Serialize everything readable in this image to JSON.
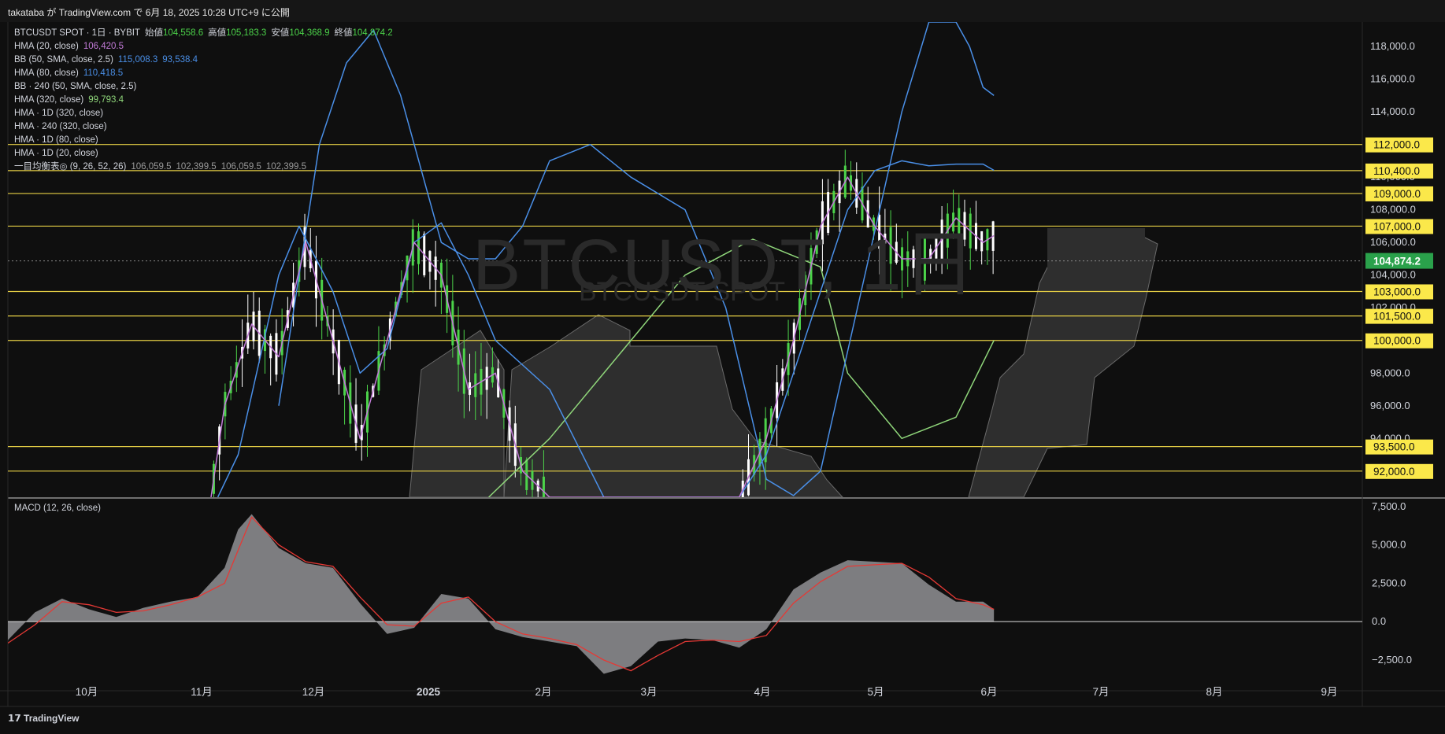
{
  "header": {
    "text": "takataba が TradingView.com で 6月 18, 2025 10:28 UTC+9 に公開"
  },
  "footer": {
    "brand": "TradingView"
  },
  "watermark": {
    "main": "BTCUSDT, 1日",
    "sub": "BTCUSDT SPOT"
  },
  "colors": {
    "bg": "#0f0f0f",
    "up": "#4cd34a",
    "down": "#ffffff",
    "bb": "#4a8fe7",
    "hma20": "#c27bd8",
    "hma320": "#8fd67a",
    "level": "#e6cf45",
    "level_label_bg": "#fbe84a",
    "price_label_bg": "#2aa14b",
    "macd_hist": "#7d7d80",
    "macd_signal": "#e53935"
  },
  "legend": [
    {
      "label": "BTCUSDT SPOT · 1日 · BYBIT",
      "parts": [
        [
          "始値",
          "104,558.6"
        ],
        [
          "高値",
          "105,183.3"
        ],
        [
          "安値",
          "104,368.9"
        ],
        [
          "終値",
          "104,874.2"
        ]
      ]
    },
    {
      "label": "HMA (20, close)",
      "values": [
        "106,420.5"
      ],
      "color": "#c27bd8"
    },
    {
      "label": "BB (50, SMA, close, 2.5)",
      "values": [
        "115,008.3",
        "93,538.4"
      ],
      "color": "#4a8fe7"
    },
    {
      "label": "HMA (80, close)",
      "values": [
        "110,418.5"
      ],
      "color": "#4a8fe7"
    },
    {
      "label": "BB · 240 (50, SMA, close, 2.5)",
      "values": []
    },
    {
      "label": "HMA (320, close)",
      "values": [
        "99,793.4"
      ],
      "color": "#8fd67a"
    },
    {
      "label": "HMA · 1D (320, close)",
      "values": []
    },
    {
      "label": "HMA · 240 (320, close)",
      "values": []
    },
    {
      "label": "HMA · 1D (80, close)",
      "values": []
    },
    {
      "label": "HMA · 1D (20, close)",
      "values": []
    },
    {
      "label": "一目均衡表◎ (9, 26, 52, 26)",
      "values": [
        "106,059.5",
        "102,399.5",
        "106,059.5",
        "102,399.5"
      ],
      "color": "#9a9a9a"
    }
  ],
  "macd_label": "MACD (12, 26, close)",
  "chart_data": [
    {
      "type": "line",
      "title": "BTCUSDT SPOT · 1日 · BYBIT",
      "ylim": [
        90400,
        119500
      ],
      "y_ticks": [
        "94,000.0",
        "96,000.0",
        "98,000.0",
        "100,000.0",
        "102,000.0",
        "104,000.0",
        "106,000.0",
        "108,000.0",
        "110,000.0",
        "112,000.0",
        "114,000.0",
        "116,000.0",
        "118,000.0"
      ],
      "y_tick_values": [
        94000,
        96000,
        98000,
        100000,
        102000,
        104000,
        106000,
        108000,
        110000,
        112000,
        114000,
        116000,
        118000
      ],
      "x_ticks": [
        "10月",
        "11月",
        "12月",
        "2025",
        "2月",
        "3月",
        "4月",
        "5月",
        "6月",
        "7月",
        "8月",
        "9月"
      ],
      "current_price": {
        "value": 104874.2,
        "label": "104,874.2"
      },
      "levels": [
        {
          "value": 112000,
          "label": "112,000.0"
        },
        {
          "value": 110400,
          "label": "110,400.0"
        },
        {
          "value": 109000,
          "label": "109,000.0"
        },
        {
          "value": 107000,
          "label": "107,000.0"
        },
        {
          "value": 103000,
          "label": "103,000.0"
        },
        {
          "value": 101500,
          "label": "101,500.0"
        },
        {
          "value": 100000,
          "label": "100,000.0"
        },
        {
          "value": 93500,
          "label": "93,500.0"
        },
        {
          "value": 92000,
          "label": "92,000.0"
        }
      ],
      "series": [
        {
          "name": "HMA (320, close)",
          "x": [
            0.355,
            0.4,
            0.45,
            0.5,
            0.55,
            0.6,
            0.62,
            0.66,
            0.7,
            0.728
          ],
          "values": [
            90400,
            94000,
            99000,
            104000,
            106200,
            104500,
            98000,
            94000,
            95300,
            100000
          ]
        },
        {
          "name": "BB (50, SMA, close, 2.5)",
          "x": [
            0.2,
            0.23,
            0.25,
            0.27,
            0.29,
            0.32,
            0.34,
            0.36,
            0.38,
            0.4,
            0.43,
            0.46,
            0.5,
            0.53,
            0.56,
            0.58,
            0.6,
            0.63,
            0.66,
            0.68,
            0.7,
            0.71,
            0.72,
            0.728
          ],
          "values": [
            96000,
            112000,
            117000,
            119000,
            115000,
            106000,
            105000,
            105000,
            107000,
            111000,
            112000,
            110000,
            108000,
            102000,
            91500,
            90500,
            92000,
            103000,
            114000,
            119500,
            119500,
            118000,
            115500,
            115000
          ]
        },
        {
          "name": "HMA (80, close)",
          "x": [
            0.155,
            0.17,
            0.2,
            0.215,
            0.24,
            0.26,
            0.28,
            0.3,
            0.32,
            0.34,
            0.36,
            0.4,
            0.44,
            0.48,
            0.5,
            0.52,
            0.54,
            0.56,
            0.6,
            0.62,
            0.64,
            0.66,
            0.68,
            0.7,
            0.72,
            0.728
          ],
          "values": [
            90400,
            93000,
            104000,
            107000,
            103000,
            98000,
            99500,
            106000,
            107200,
            104000,
            100000,
            97000,
            90400,
            90400,
            90400,
            90400,
            90400,
            93000,
            103000,
            108000,
            110400,
            111000,
            110700,
            110800,
            110800,
            110418
          ]
        },
        {
          "name": "HMA (20, close)",
          "x": [
            0.15,
            0.16,
            0.18,
            0.2,
            0.22,
            0.24,
            0.26,
            0.28,
            0.3,
            0.32,
            0.34,
            0.36,
            0.38,
            0.4,
            0.42,
            0.44,
            0.46,
            0.48,
            0.5,
            0.52,
            0.54,
            0.56,
            0.58,
            0.6,
            0.62,
            0.64,
            0.66,
            0.68,
            0.7,
            0.72,
            0.728
          ],
          "values": [
            90400,
            96000,
            101000,
            99000,
            106000,
            100000,
            94000,
            100000,
            106000,
            104000,
            97000,
            98000,
            92000,
            90400,
            90400,
            90400,
            90400,
            90400,
            90400,
            90400,
            90400,
            94000,
            100000,
            107000,
            110000,
            107000,
            105000,
            105000,
            107500,
            106000,
            106420
          ]
        }
      ]
    },
    {
      "type": "area",
      "title": "MACD (12, 26, close)",
      "ylim": [
        -4500,
        8000
      ],
      "y_ticks": [
        "7,500.0",
        "5,000.0",
        "2,500.0",
        "0.0",
        "−2,500.0"
      ],
      "y_tick_values": [
        7500,
        5000,
        2500,
        0,
        -2500
      ],
      "series": [
        {
          "name": "MACD",
          "x": [
            0,
            0.02,
            0.04,
            0.06,
            0.08,
            0.1,
            0.12,
            0.14,
            0.16,
            0.17,
            0.18,
            0.2,
            0.22,
            0.24,
            0.26,
            0.28,
            0.3,
            0.32,
            0.34,
            0.36,
            0.38,
            0.4,
            0.42,
            0.44,
            0.46,
            0.48,
            0.5,
            0.52,
            0.54,
            0.56,
            0.58,
            0.6,
            0.62,
            0.64,
            0.66,
            0.68,
            0.7,
            0.72,
            0.728
          ],
          "values": [
            -1200,
            600,
            1500,
            800,
            300,
            900,
            1300,
            1600,
            3500,
            6000,
            7000,
            4800,
            3800,
            3500,
            1200,
            -800,
            -400,
            1800,
            1500,
            -500,
            -1000,
            -1300,
            -1600,
            -3400,
            -2900,
            -1300,
            -1100,
            -1200,
            -1700,
            -500,
            2100,
            3200,
            4000,
            3900,
            3800,
            2400,
            1300,
            1300,
            800
          ]
        },
        {
          "name": "Signal",
          "x": [
            0,
            0.02,
            0.04,
            0.06,
            0.08,
            0.1,
            0.12,
            0.14,
            0.16,
            0.18,
            0.2,
            0.22,
            0.24,
            0.26,
            0.28,
            0.3,
            0.32,
            0.34,
            0.36,
            0.38,
            0.4,
            0.42,
            0.44,
            0.46,
            0.48,
            0.5,
            0.52,
            0.54,
            0.56,
            0.58,
            0.6,
            0.62,
            0.64,
            0.66,
            0.68,
            0.7,
            0.72,
            0.728
          ],
          "values": [
            -1400,
            -200,
            1300,
            1100,
            600,
            700,
            1100,
            1600,
            2500,
            6800,
            5000,
            3900,
            3600,
            1600,
            -200,
            -300,
            1200,
            1600,
            0,
            -800,
            -1100,
            -1500,
            -2500,
            -3200,
            -2200,
            -1300,
            -1200,
            -1300,
            -900,
            1200,
            2600,
            3600,
            3700,
            3800,
            2900,
            1500,
            1100,
            800
          ]
        }
      ]
    }
  ]
}
